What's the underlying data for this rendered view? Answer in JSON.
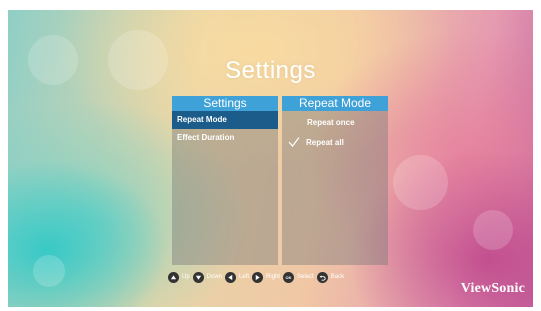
{
  "title": "Settings",
  "left_panel": {
    "header": "Settings",
    "items": [
      {
        "label": "Repeat Mode",
        "selected": true
      },
      {
        "label": "Effect Duration",
        "selected": false
      }
    ]
  },
  "right_panel": {
    "header": "Repeat Mode",
    "options": [
      {
        "label": "Repeat once",
        "checked": false
      },
      {
        "label": "Repeat all",
        "checked": true
      }
    ]
  },
  "legend": [
    {
      "icon": "up-icon",
      "label": "Up"
    },
    {
      "icon": "down-icon",
      "label": "Down"
    },
    {
      "icon": "left-icon",
      "label": "Left"
    },
    {
      "icon": "right-icon",
      "label": "Right"
    },
    {
      "icon": "ok-icon",
      "label": "Select",
      "icon_text": "OK"
    },
    {
      "icon": "back-icon",
      "label": "Back"
    }
  ],
  "brand": "ViewSonic",
  "colors": {
    "accent": "#3ea1d8",
    "selected": "#1b5c8a"
  }
}
